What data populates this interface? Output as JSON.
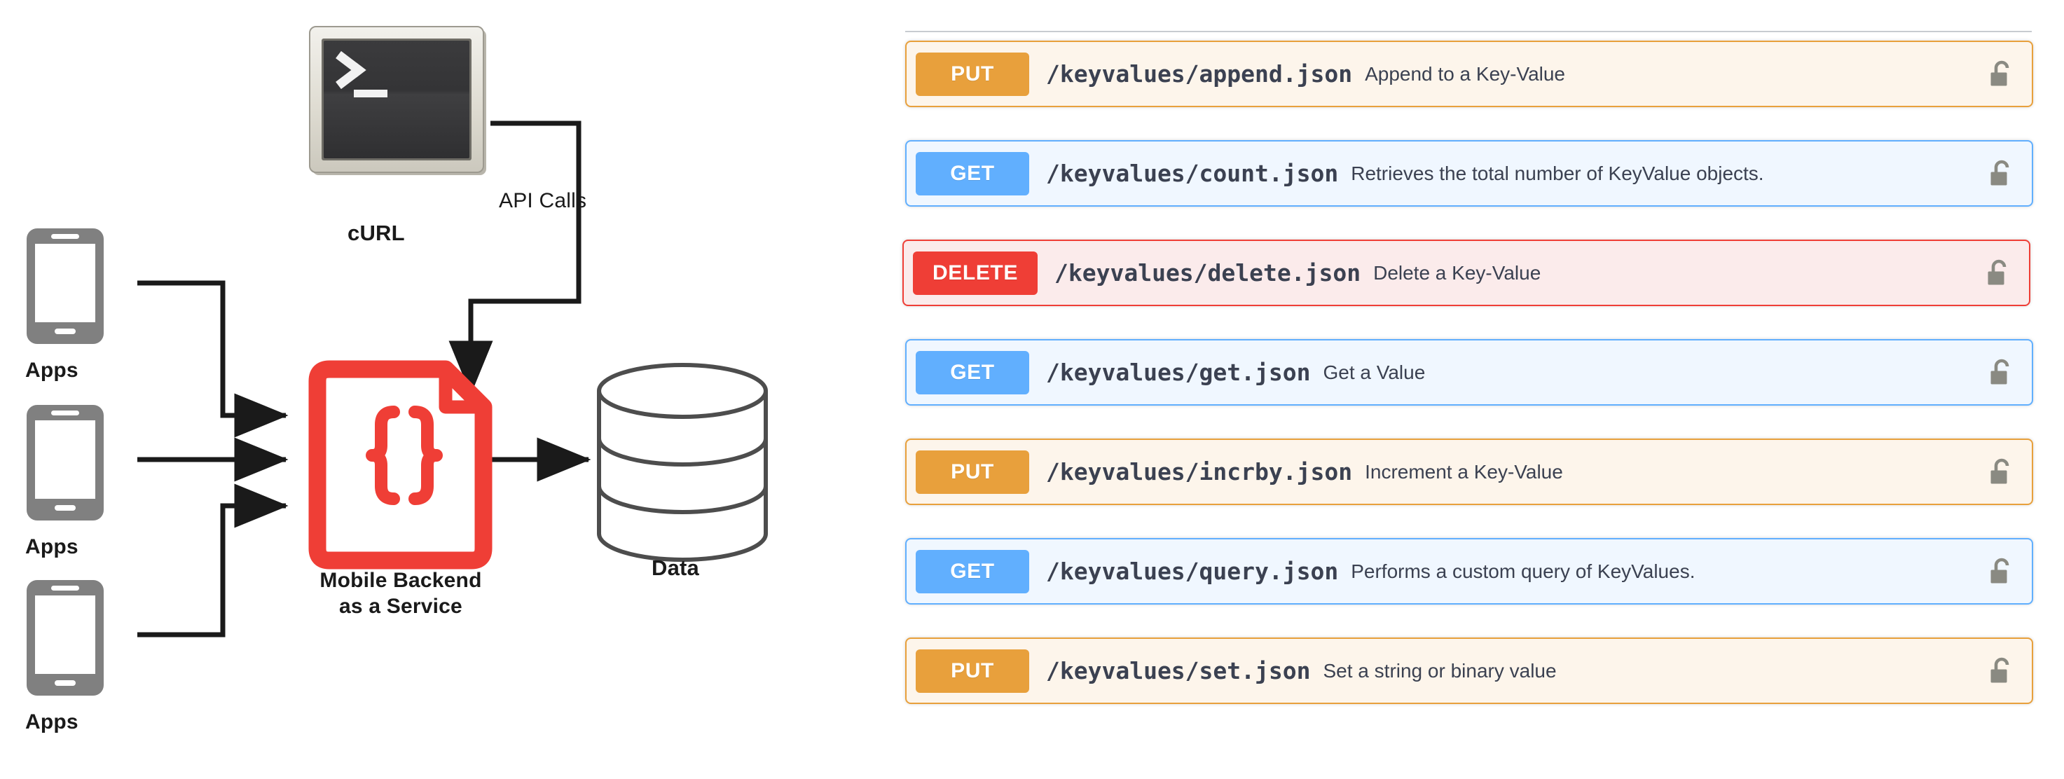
{
  "diagram": {
    "clients": [
      {
        "label": "Apps",
        "icon": "mobile-phone-icon"
      },
      {
        "label": "Apps",
        "icon": "mobile-phone-icon"
      },
      {
        "label": "Apps",
        "icon": "mobile-phone-icon"
      }
    ],
    "terminal": {
      "label": "cURL",
      "icon": "terminal-icon",
      "prompt": ">",
      "cursor": "_"
    },
    "backend": {
      "label_line1": "Mobile Backend",
      "label_line2": "as a Service",
      "icon": "json-document-icon",
      "glyph": "{}"
    },
    "storage": {
      "label": "Data",
      "icon": "database-cylinder-icon"
    },
    "connector_label": "API Calls",
    "colors": {
      "backend_red": "#ef3e36",
      "device_gray": "#808080",
      "arrow_black": "#1a1a1a",
      "cylinder_stroke": "#4d4d4d"
    }
  },
  "operations": {
    "lock_icon": "unlocked-padlock-icon",
    "colors": {
      "get": "#61affe",
      "put": "#e8a03c",
      "delete": "#ef3e36",
      "text": "#3b4151",
      "divider": "#c8cbd0"
    },
    "items": [
      {
        "method": "PUT",
        "method_class": "m-put",
        "path": "/keyvalues/append.json",
        "summary": "Append to a Key-Value"
      },
      {
        "method": "GET",
        "method_class": "m-get",
        "path": "/keyvalues/count.json",
        "summary": "Retrieves the total number of KeyValue objects."
      },
      {
        "method": "DELETE",
        "method_class": "m-delete",
        "path": "/keyvalues/delete.json",
        "summary": "Delete a Key-Value"
      },
      {
        "method": "GET",
        "method_class": "m-get",
        "path": "/keyvalues/get.json",
        "summary": "Get a Value"
      },
      {
        "method": "PUT",
        "method_class": "m-put",
        "path": "/keyvalues/incrby.json",
        "summary": "Increment a Key-Value"
      },
      {
        "method": "GET",
        "method_class": "m-get",
        "path": "/keyvalues/query.json",
        "summary": "Performs a custom query of KeyValues."
      },
      {
        "method": "PUT",
        "method_class": "m-put",
        "path": "/keyvalues/set.json",
        "summary": "Set a string or binary value"
      }
    ]
  }
}
